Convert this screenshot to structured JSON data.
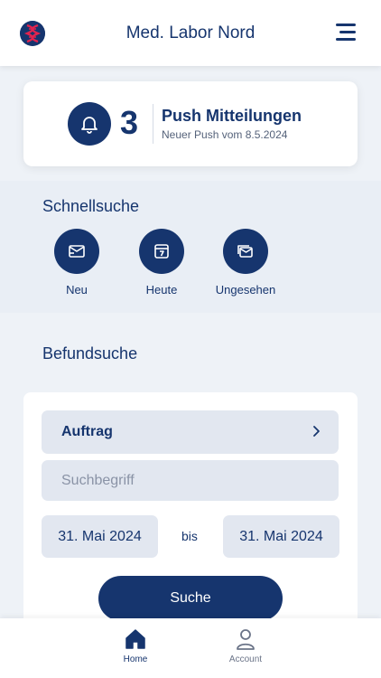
{
  "header": {
    "title": "Med. Labor Nord",
    "logo_icon": "lab-logo-icon",
    "menu_icon": "hamburger-menu-icon"
  },
  "push": {
    "count": "3",
    "title": "Push Mitteilungen",
    "subtitle": "Neuer Push vom 8.5.2024",
    "icon": "bell-icon"
  },
  "quick_search": {
    "title": "Schnellsuche",
    "items": [
      {
        "label": "Neu",
        "icon": "new-inbox-icon"
      },
      {
        "label": "Heute",
        "icon": "calendar-today-icon"
      },
      {
        "label": "Ungesehen",
        "icon": "unseen-mail-icon"
      }
    ]
  },
  "result_search": {
    "title": "Befundsuche",
    "order_label": "Auftrag",
    "search_placeholder": "Suchbegriff",
    "date_from": "31. Mai 2024",
    "date_separator": "bis",
    "date_to": "31. Mai 2024",
    "search_button": "Suche"
  },
  "nav": {
    "items": [
      {
        "label": "Home",
        "icon": "home-icon",
        "active": true
      },
      {
        "label": "Account",
        "icon": "account-icon",
        "active": false
      }
    ]
  },
  "colors": {
    "primary": "#16356e",
    "accent": "#e2234e",
    "background": "#eef2f7",
    "field": "#e2e7f0"
  }
}
